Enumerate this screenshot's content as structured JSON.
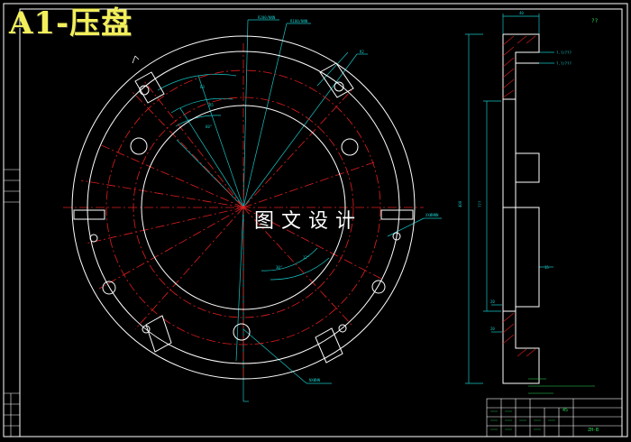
{
  "title": "A1-压盘",
  "watermark": "图文设计",
  "colors": {
    "background": "#000000",
    "outline": "#ffffff",
    "centerline": "#e01e1e",
    "dimension": "#17c4c4",
    "note": "#2fe05a",
    "title_text": "#f2ef5a"
  },
  "title_block": {
    "material": "45",
    "drawing_no": "ZH-B"
  },
  "corner_mark": "??"
}
